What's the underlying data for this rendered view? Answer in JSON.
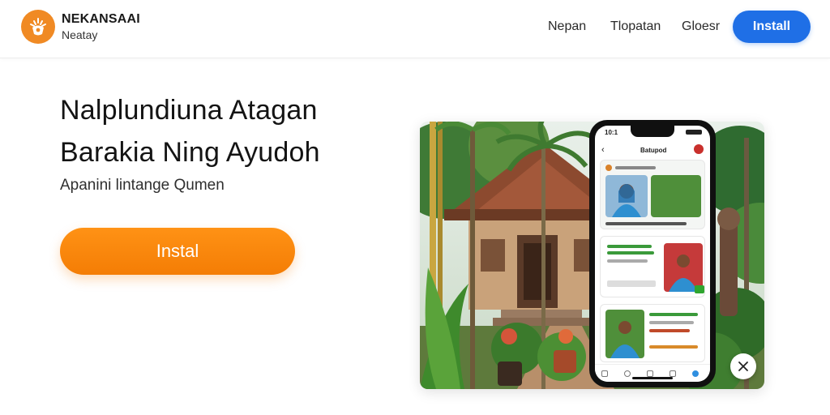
{
  "header": {
    "brand_name": "NEKANSAAI",
    "brand_sub": "Neatay",
    "nav": [
      "Nepan",
      "Tlopatan",
      "Gloesr"
    ],
    "install_label": "Install"
  },
  "hero": {
    "headline_line1": "Nalplundiuna Atagan",
    "headline_line2": "Barakia Ning Ayudoh",
    "subtitle": "Apanini lintange Qumen",
    "cta_label": "Instal"
  },
  "phone": {
    "time": "10:1",
    "app_title": "Batupod"
  },
  "colors": {
    "brand_orange": "#f08a24",
    "cta_orange": "#f7820a",
    "install_blue": "#1f6fe6"
  }
}
